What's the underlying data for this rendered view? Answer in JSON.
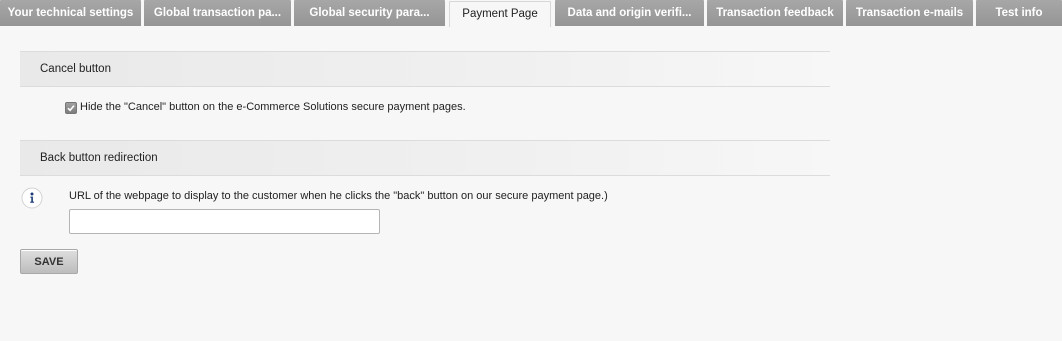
{
  "tabs": [
    {
      "label": "Your technical settings",
      "active": false
    },
    {
      "label": "Global transaction pa...",
      "active": false
    },
    {
      "label": "Global security para...",
      "active": false
    },
    {
      "label": "Payment Page",
      "active": true
    },
    {
      "label": "Data and origin verifi...",
      "active": false
    },
    {
      "label": "Transaction feedback",
      "active": false
    },
    {
      "label": "Transaction e-mails",
      "active": false
    },
    {
      "label": "Test info",
      "active": false
    }
  ],
  "cancel_section": {
    "title": "Cancel button",
    "checkbox_label": "Hide the \"Cancel\" button on the e-Commerce Solutions secure payment pages.",
    "checked": true
  },
  "back_section": {
    "title": "Back button redirection",
    "url_label": "URL of the webpage to display to the customer when he clicks the \"back\" button on our secure payment page.)",
    "url_value": ""
  },
  "save_label": "SAVE"
}
